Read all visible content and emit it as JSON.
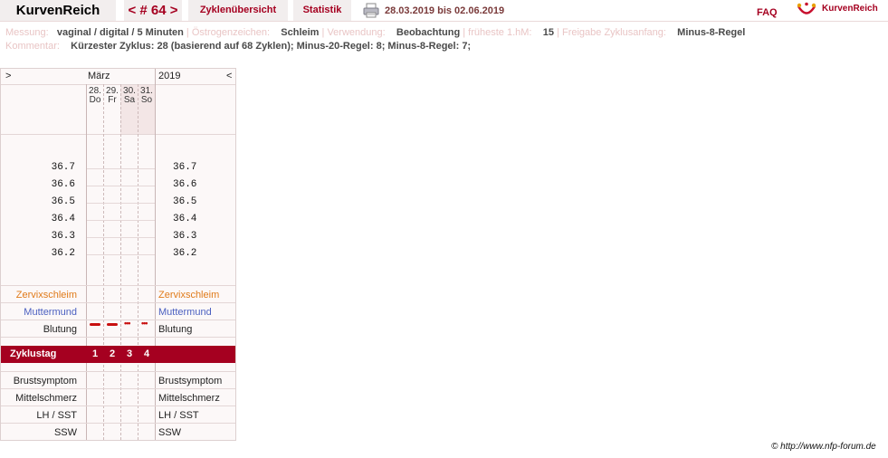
{
  "header": {
    "brand": "KurvenReich",
    "cycle_nav": "< # 64 >",
    "tab_overview": "Zyklenübersicht",
    "tab_stats": "Statistik",
    "date_range": "28.03.2019 bis 02.06.2019",
    "faq": "FAQ",
    "logo_text": "KurvenReich",
    "print_icon": "printer-icon",
    "logo_icon": "kurvenreich-logo-icon"
  },
  "info": {
    "messung_label": "Messung:",
    "messung_value": "vaginal / digital / 5 Minuten",
    "oestrogen_label": "Östrogenzeichen:",
    "oestrogen_value": "Schleim",
    "verwendung_label": "Verwendung:",
    "verwendung_value": "Beobachtung",
    "frueheste_label": "früheste 1.hM:",
    "frueheste_value": "15",
    "freigabe_label": "Freigabe Zyklusanfang:",
    "freigabe_value": "Minus-8-Regel",
    "kommentar_label": "Kommentar:",
    "kommentar_value": "Kürzester Zyklus: 28 (basierend auf 68 Zyklen);  Minus-20-Regel: 8; Minus-8-Regel: 7;",
    "separator": "|"
  },
  "chart": {
    "nav_left": ">",
    "nav_right": "<",
    "month": "März",
    "year": "2019",
    "days": [
      {
        "date": "28.",
        "weekday": "Do"
      },
      {
        "date": "29.",
        "weekday": "Fr"
      },
      {
        "date": "30.",
        "weekday": "Sa"
      },
      {
        "date": "31.",
        "weekday": "So"
      }
    ],
    "temperatures": [
      "36.7",
      "36.6",
      "36.5",
      "36.4",
      "36.3",
      "36.2"
    ],
    "rows": {
      "zervixschleim": "Zervixschleim",
      "muttermund": "Muttermund",
      "blutung": "Blutung",
      "zyklustag": "Zyklustag",
      "brustsymptom": "Brustsymptom",
      "mittelschmerz": "Mittelschmerz",
      "lh_sst": "LH / SST",
      "ssw": "SSW"
    },
    "cycle_days": [
      "1",
      "2",
      "3",
      "4"
    ],
    "bleeding": [
      "heavy",
      "heavy",
      "light",
      "light"
    ],
    "colors": {
      "accent": "#a50020",
      "bleeding": "#c81010",
      "zervix": "#e07b1a",
      "muttermund": "#4a5fc0"
    }
  },
  "footer": {
    "copyright": "© http://www.nfp-forum.de"
  }
}
